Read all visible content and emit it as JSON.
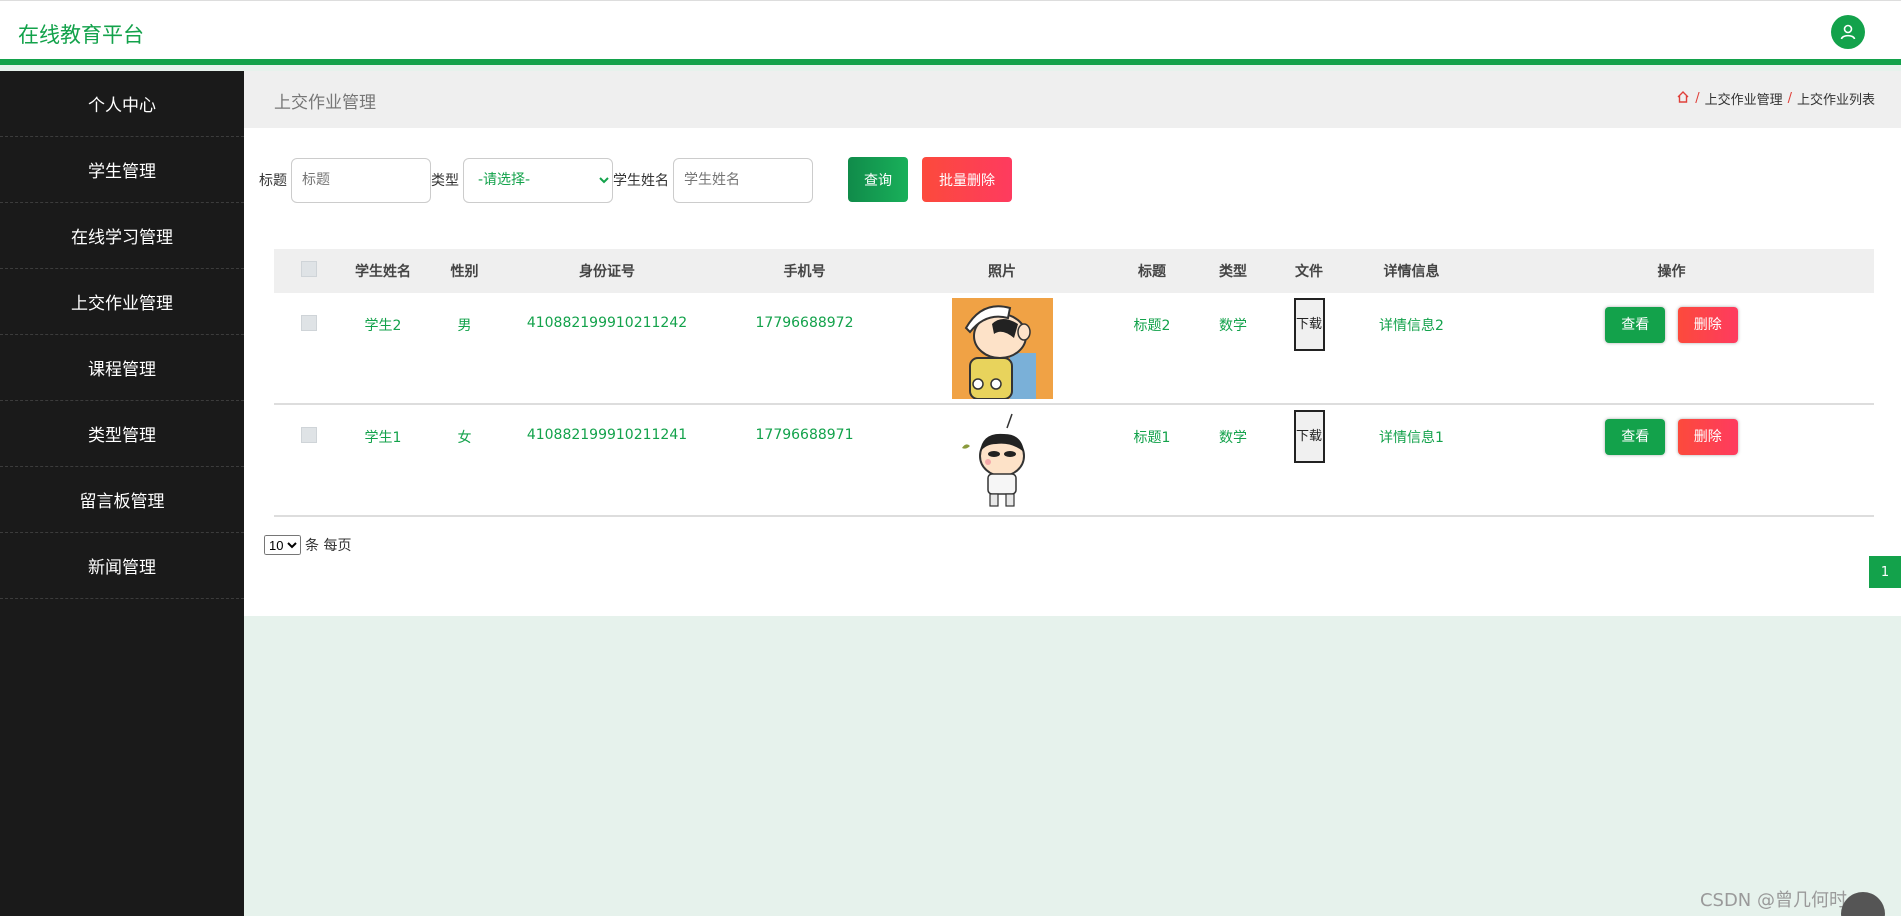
{
  "header": {
    "brand": "在线教育平台",
    "user_icon": "user-icon"
  },
  "sidebar": {
    "items": [
      {
        "label": "个人中心"
      },
      {
        "label": "学生管理"
      },
      {
        "label": "在线学习管理"
      },
      {
        "label": "上交作业管理"
      },
      {
        "label": "课程管理"
      },
      {
        "label": "类型管理"
      },
      {
        "label": "留言板管理"
      },
      {
        "label": "新闻管理"
      }
    ]
  },
  "page": {
    "title": "上交作业管理",
    "breadcrumb": [
      "上交作业管理",
      "上交作业列表"
    ]
  },
  "search": {
    "title_label": "标题",
    "title_placeholder": "标题",
    "type_label": "类型",
    "type_selected": "-请选择-",
    "name_label": "学生姓名",
    "name_placeholder": "学生姓名",
    "query_button": "查询",
    "batch_delete_button": "批量删除"
  },
  "table": {
    "headers": [
      "学生姓名",
      "性别",
      "身份证号",
      "手机号",
      "照片",
      "标题",
      "类型",
      "文件",
      "详情信息",
      "操作"
    ],
    "rows": [
      {
        "name": "学生2",
        "gender": "男",
        "id_card": "410882199910211242",
        "phone": "17796688972",
        "title": "标题2",
        "type": "数学",
        "file_button": "下载",
        "detail": "详情信息2",
        "view": "查看",
        "delete": "删除"
      },
      {
        "name": "学生1",
        "gender": "女",
        "id_card": "410882199910211241",
        "phone": "17796688971",
        "title": "标题1",
        "type": "数学",
        "file_button": "下载",
        "detail": "详情信息1",
        "view": "查看",
        "delete": "删除"
      }
    ]
  },
  "pagination": {
    "page_size": "10",
    "page_size_suffix": "条 每页",
    "current_page": "1"
  },
  "watermark": "CSDN @曾几何时…",
  "float_button": "..."
}
